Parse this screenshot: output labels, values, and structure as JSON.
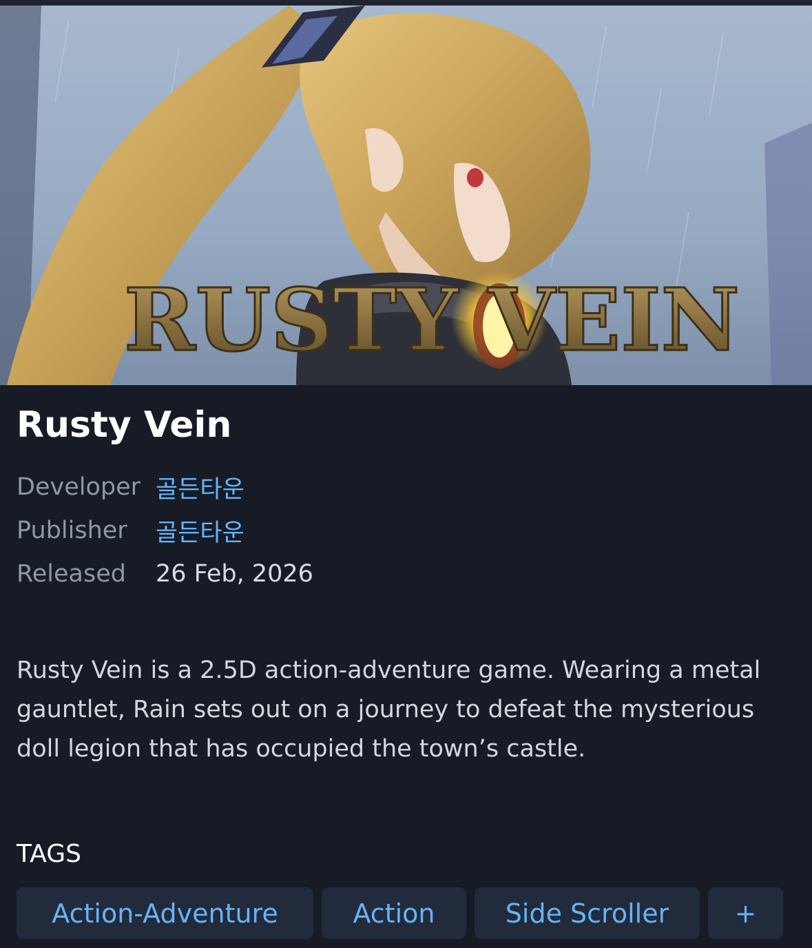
{
  "game": {
    "title": "Rusty Vein",
    "logo_text": "RUSTY VEIN",
    "developer_label": "Developer",
    "developer": "골든타운",
    "publisher_label": "Publisher",
    "publisher": "골든타운",
    "released_label": "Released",
    "release_date": "26 Feb, 2026",
    "description": "Rusty Vein is a 2.5D action-adventure game. Wearing a metal gauntlet, Rain sets out on a journey to defeat the mysterious doll legion that has occupied the town’s castle."
  },
  "tags": {
    "heading": "TAGS",
    "items": [
      "Action-Adventure",
      "Action",
      "Side Scroller",
      "+"
    ]
  },
  "colors": {
    "background": "#161b26",
    "link": "#67b4f5",
    "tag_background": "#222b3b",
    "label": "#8f98a6"
  }
}
